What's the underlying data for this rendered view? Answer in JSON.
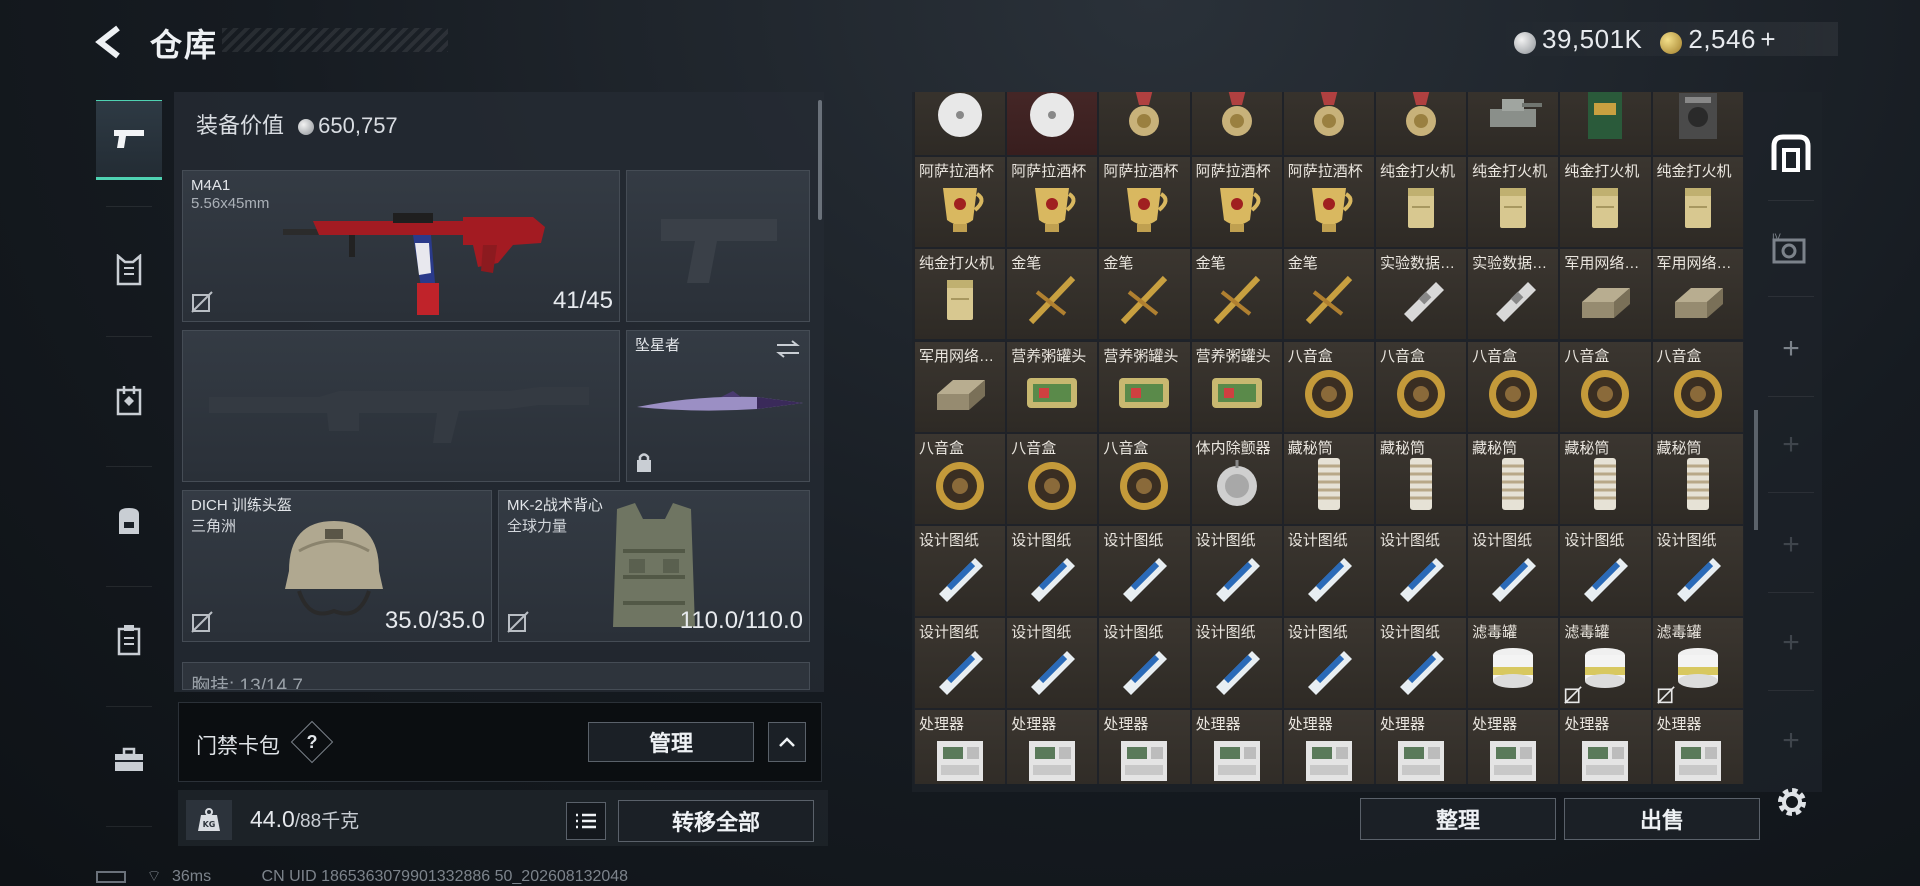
{
  "header": {
    "title": "仓库",
    "currency_silver": "39,501K",
    "currency_gold": "2,546",
    "add_label": "+"
  },
  "loadout": {
    "equip_value_label": "装备价值",
    "equip_value": "650,757",
    "primary_weapon": {
      "name": "M4A1",
      "ammo_type": "5.56x45mm",
      "ammo": "41/45"
    },
    "melee": {
      "name": "坠星者"
    },
    "helmet": {
      "name": "DICH 训练头盔",
      "brand": "三角洲",
      "durability": "35.0/35.0"
    },
    "armor": {
      "name": "MK-2战术背心",
      "brand": "全球力量",
      "durability": "110.0/110.0"
    },
    "chest_rig_peek": "胸挂: 13/14 7"
  },
  "keycard": {
    "label": "门禁卡包",
    "help": "?",
    "manage": "管理"
  },
  "weight": {
    "current": "44.0",
    "max": "/88千克",
    "icon": "KG"
  },
  "actions": {
    "transfer_all": "转移全部",
    "organize": "整理",
    "sell": "出售"
  },
  "status": {
    "ping": "36ms",
    "uid": "CN UID 1865363079901332886 50_202608132048"
  },
  "stash": {
    "rows": [
      [
        {
          "name": "",
          "icon": "disc",
          "red": false
        },
        {
          "name": "",
          "icon": "disc",
          "red": true
        },
        {
          "name": "",
          "icon": "medal",
          "red": false
        },
        {
          "name": "",
          "icon": "medal",
          "red": false
        },
        {
          "name": "",
          "icon": "medal",
          "red": false
        },
        {
          "name": "",
          "icon": "medal",
          "red": false
        },
        {
          "name": "",
          "icon": "tank",
          "red": false
        },
        {
          "name": "",
          "icon": "book",
          "red": false
        },
        {
          "name": "",
          "icon": "radio",
          "red": false
        }
      ],
      [
        {
          "name": "阿萨拉酒杯",
          "icon": "cup"
        },
        {
          "name": "阿萨拉酒杯",
          "icon": "cup"
        },
        {
          "name": "阿萨拉酒杯",
          "icon": "cup"
        },
        {
          "name": "阿萨拉酒杯",
          "icon": "cup"
        },
        {
          "name": "阿萨拉酒杯",
          "icon": "cup"
        },
        {
          "name": "纯金打火机",
          "icon": "lighter"
        },
        {
          "name": "纯金打火机",
          "icon": "lighter"
        },
        {
          "name": "纯金打火机",
          "icon": "lighter"
        },
        {
          "name": "纯金打火机",
          "icon": "lighter"
        }
      ],
      [
        {
          "name": "纯金打火机",
          "icon": "lighter"
        },
        {
          "name": "金笔",
          "icon": "pen"
        },
        {
          "name": "金笔",
          "icon": "pen"
        },
        {
          "name": "金笔",
          "icon": "pen"
        },
        {
          "name": "金笔",
          "icon": "pen"
        },
        {
          "name": "实验数据…",
          "icon": "drive"
        },
        {
          "name": "实验数据…",
          "icon": "drive"
        },
        {
          "name": "军用网络…",
          "icon": "router"
        },
        {
          "name": "军用网络…",
          "icon": "router"
        }
      ],
      [
        {
          "name": "军用网络…",
          "icon": "router"
        },
        {
          "name": "营养粥罐头",
          "icon": "can"
        },
        {
          "name": "营养粥罐头",
          "icon": "can"
        },
        {
          "name": "营养粥罐头",
          "icon": "can"
        },
        {
          "name": "八音盒",
          "icon": "musicbox"
        },
        {
          "name": "八音盒",
          "icon": "musicbox"
        },
        {
          "name": "八音盒",
          "icon": "musicbox"
        },
        {
          "name": "八音盒",
          "icon": "musicbox"
        },
        {
          "name": "八音盒",
          "icon": "musicbox"
        }
      ],
      [
        {
          "name": "八音盒",
          "icon": "musicbox"
        },
        {
          "name": "八音盒",
          "icon": "musicbox"
        },
        {
          "name": "八音盒",
          "icon": "musicbox"
        },
        {
          "name": "体内除颤器",
          "icon": "defib"
        },
        {
          "name": "藏秘筒",
          "icon": "cryptex"
        },
        {
          "name": "藏秘筒",
          "icon": "cryptex"
        },
        {
          "name": "藏秘筒",
          "icon": "cryptex"
        },
        {
          "name": "藏秘筒",
          "icon": "cryptex"
        },
        {
          "name": "藏秘筒",
          "icon": "cryptex"
        }
      ],
      [
        {
          "name": "设计图纸",
          "icon": "blueprint"
        },
        {
          "name": "设计图纸",
          "icon": "blueprint"
        },
        {
          "name": "设计图纸",
          "icon": "blueprint"
        },
        {
          "name": "设计图纸",
          "icon": "blueprint"
        },
        {
          "name": "设计图纸",
          "icon": "blueprint"
        },
        {
          "name": "设计图纸",
          "icon": "blueprint"
        },
        {
          "name": "设计图纸",
          "icon": "blueprint"
        },
        {
          "name": "设计图纸",
          "icon": "blueprint"
        },
        {
          "name": "设计图纸",
          "icon": "blueprint"
        }
      ],
      [
        {
          "name": "设计图纸",
          "icon": "blueprint"
        },
        {
          "name": "设计图纸",
          "icon": "blueprint"
        },
        {
          "name": "设计图纸",
          "icon": "blueprint"
        },
        {
          "name": "设计图纸",
          "icon": "blueprint"
        },
        {
          "name": "设计图纸",
          "icon": "blueprint"
        },
        {
          "name": "设计图纸",
          "icon": "blueprint"
        },
        {
          "name": "滤毒罐",
          "icon": "filter"
        },
        {
          "name": "滤毒罐",
          "icon": "filter",
          "noinsure": true
        },
        {
          "name": "滤毒罐",
          "icon": "filter",
          "noinsure": true
        }
      ],
      [
        {
          "name": "处理器",
          "icon": "processor"
        },
        {
          "name": "处理器",
          "icon": "processor"
        },
        {
          "name": "处理器",
          "icon": "processor"
        },
        {
          "name": "处理器",
          "icon": "processor"
        },
        {
          "name": "处理器",
          "icon": "processor"
        },
        {
          "name": "处理器",
          "icon": "processor"
        },
        {
          "name": "处理器",
          "icon": "processor"
        },
        {
          "name": "处理器",
          "icon": "processor"
        },
        {
          "name": "处理器",
          "icon": "processor"
        }
      ]
    ]
  }
}
